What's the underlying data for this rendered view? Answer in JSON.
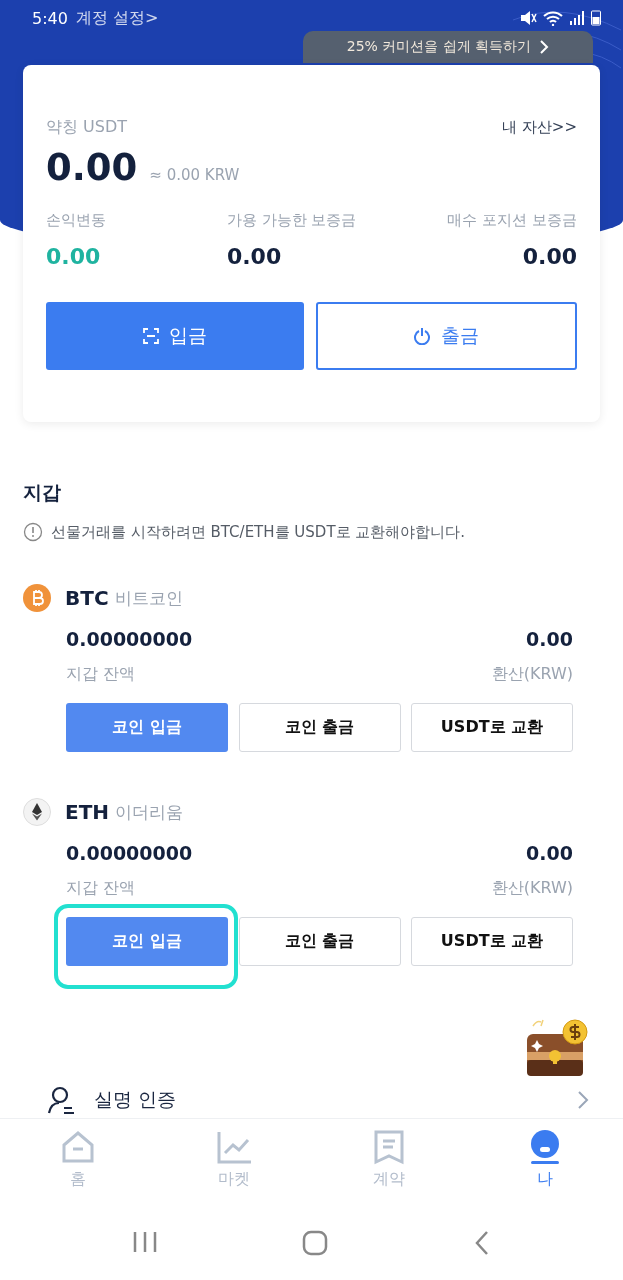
{
  "status_bar": {
    "time": "5:40",
    "overlay_title": "계정 설정>"
  },
  "promo": {
    "text": "25% 커미션을 쉽게 획득하기"
  },
  "account_card": {
    "label": "약칭 USDT",
    "link": "내 자산>>",
    "balance": "0.00",
    "balance_krw": "≈ 0.00 KRW",
    "stats": [
      {
        "label": "손익변동",
        "value": "0.00",
        "kind": "profit"
      },
      {
        "label": "가용 가능한 보증금",
        "value": "0.00",
        "kind": "plain"
      },
      {
        "label": "매수 포지션 보증금",
        "value": "0.00",
        "kind": "plain"
      }
    ],
    "buttons": [
      {
        "label": "입금",
        "kind": "primary"
      },
      {
        "label": "출금",
        "kind": "outline"
      }
    ]
  },
  "wallet": {
    "title": "지갑",
    "notice": "선물거래를 시작하려면 BTC/ETH를 USDT로 교환해야합니다.",
    "coins": [
      {
        "symbol": "BTC",
        "name": "비트코인",
        "balance": "0.00000000",
        "balance_label": "지갑 잔액",
        "converted": "0.00",
        "converted_label": "환산(KRW)",
        "buttons": [
          {
            "label": "코인 입금",
            "kind": "primary",
            "highlighted": false
          },
          {
            "label": "코인 출금",
            "kind": "outline",
            "highlighted": false
          },
          {
            "label": "USDT로 교환",
            "kind": "outline",
            "highlighted": false
          }
        ]
      },
      {
        "symbol": "ETH",
        "name": "이더리움",
        "balance": "0.00000000",
        "balance_label": "지갑 잔액",
        "converted": "0.00",
        "converted_label": "환산(KRW)",
        "buttons": [
          {
            "label": "코인 입금",
            "kind": "primary",
            "highlighted": true
          },
          {
            "label": "코인 출금",
            "kind": "outline",
            "highlighted": false
          },
          {
            "label": "USDT로 교환",
            "kind": "outline",
            "highlighted": false
          }
        ]
      }
    ]
  },
  "menu_row": {
    "label": "실명 인증"
  },
  "bottom_nav": [
    {
      "label": "홈",
      "selected": false
    },
    {
      "label": "마켓",
      "selected": false
    },
    {
      "label": "계약",
      "selected": false
    },
    {
      "label": "나",
      "selected": true
    }
  ]
}
